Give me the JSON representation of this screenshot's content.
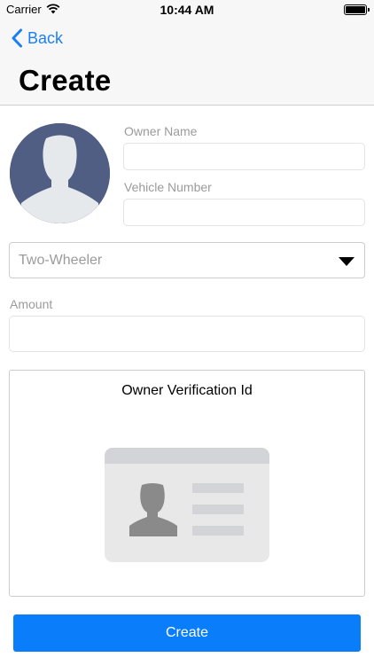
{
  "status_bar": {
    "carrier": "Carrier",
    "time": "10:44 AM"
  },
  "nav": {
    "back_label": "Back",
    "title": "Create"
  },
  "form": {
    "owner_name": {
      "label": "Owner Name",
      "value": "",
      "placeholder": ""
    },
    "vehicle_number": {
      "label": "Vehicle Number",
      "value": "",
      "placeholder": ""
    },
    "vehicle_type": {
      "selected": "Two-Wheeler"
    },
    "amount": {
      "label": "Amount",
      "value": "",
      "placeholder": ""
    }
  },
  "verification": {
    "title": "Owner Verification Id"
  },
  "actions": {
    "create_label": "Create"
  },
  "colors": {
    "accent": "#0a7dfb",
    "back_link": "#1a7ff5",
    "avatar_bg": "#505e84",
    "placeholder_text": "#9b9b9b"
  },
  "icons": [
    "wifi-icon",
    "battery-icon",
    "back-chevron-icon",
    "avatar-placeholder-icon",
    "dropdown-arrow-icon",
    "id-card-icon"
  ]
}
